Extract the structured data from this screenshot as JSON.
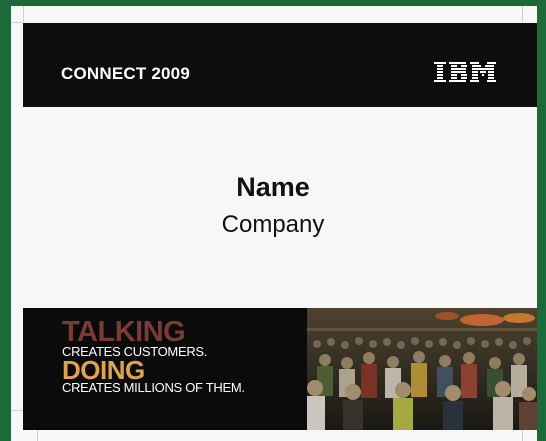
{
  "header": {
    "event_title": "CONNECT 2009",
    "logo_text": "IBM",
    "band_color": "#0d0d0d"
  },
  "badge": {
    "name": "Name",
    "company": "Company"
  },
  "footer": {
    "line1_big": "TALKING",
    "line1_small": "CREATES CUSTOMERS.",
    "line2_big": "DOING",
    "line2_small": "CREATES MILLIONS OF THEM.",
    "talking_color": "#7a3b37",
    "doing_color": "#e0a34a",
    "photo": "crowd-photo"
  },
  "colors": {
    "outer_frame": "#1a6a3a",
    "card": "#f7f7f7"
  }
}
